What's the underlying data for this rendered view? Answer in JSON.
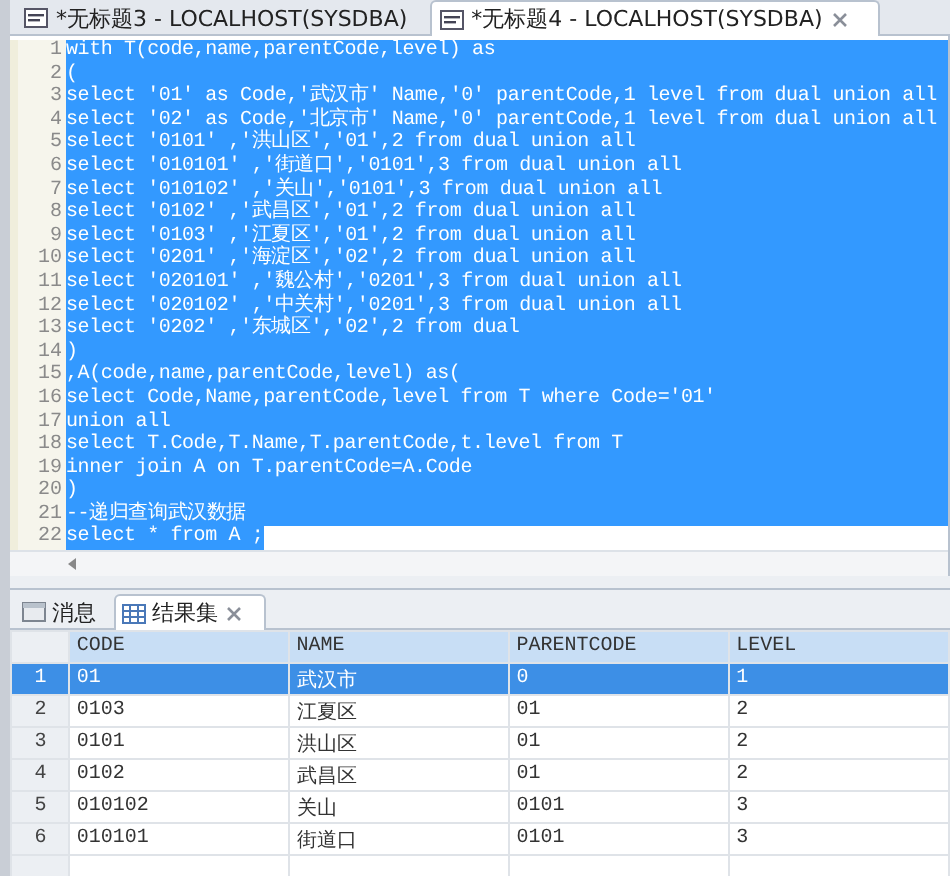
{
  "tabs": [
    {
      "label": "*无标题3 - LOCALHOST(SYSDBA)",
      "selected": false
    },
    {
      "label": "*无标题4 - LOCALHOST(SYSDBA)",
      "selected": true
    }
  ],
  "editor": {
    "lines": [
      {
        "number": "1",
        "text": "with T(code,name,parentCode,level) as",
        "kind": "full"
      },
      {
        "number": "2",
        "text": "(",
        "kind": "full"
      },
      {
        "number": "3",
        "text": "select '01' as Code,'武汉市' Name,'0' parentCode,1 level from dual union all",
        "kind": "full"
      },
      {
        "number": "4",
        "text": "select '02' as Code,'北京市' Name,'0' parentCode,1 level from dual union all",
        "kind": "full"
      },
      {
        "number": "5",
        "text": "select '0101' ,'洪山区','01',2 from dual union all",
        "kind": "full"
      },
      {
        "number": "6",
        "text": "select '010101' ,'街道口','0101',3 from dual union all",
        "kind": "full"
      },
      {
        "number": "7",
        "text": "select '010102' ,'关山','0101',3 from dual union all",
        "kind": "full"
      },
      {
        "number": "8",
        "text": "select '0102' ,'武昌区','01',2 from dual union all",
        "kind": "full"
      },
      {
        "number": "9",
        "text": "select '0103' ,'江夏区','01',2 from dual union all",
        "kind": "full"
      },
      {
        "number": "10",
        "text": "select '0201' ,'海淀区','02',2 from dual union all",
        "kind": "full"
      },
      {
        "number": "11",
        "text": "select '020101' ,'魏公村','0201',3 from dual union all",
        "kind": "full"
      },
      {
        "number": "12",
        "text": "select '020102' ,'中关村','0201',3 from dual union all",
        "kind": "full"
      },
      {
        "number": "13",
        "text": "select '0202' ,'东城区','02',2 from dual",
        "kind": "full"
      },
      {
        "number": "14",
        "text": ")",
        "kind": "full"
      },
      {
        "number": "15",
        "text": ",A(code,name,parentCode,level) as(",
        "kind": "full"
      },
      {
        "number": "16",
        "text": "select Code,Name,parentCode,level from T where Code='01'",
        "kind": "full"
      },
      {
        "number": "17",
        "text": "union all",
        "kind": "full"
      },
      {
        "number": "18",
        "text": "select T.Code,T.Name,T.parentCode,t.level from T",
        "kind": "full"
      },
      {
        "number": "19",
        "text": "inner join A on T.parentCode=A.Code",
        "kind": "full"
      },
      {
        "number": "20",
        "text": ")",
        "kind": "full"
      },
      {
        "number": "21",
        "text": "--递归查询武汉数据",
        "kind": "full"
      },
      {
        "number": "22",
        "text": "select * from A ;",
        "kind": "partial"
      }
    ]
  },
  "results": {
    "tabs": [
      {
        "label": "消息",
        "kind": "messages",
        "selected": false
      },
      {
        "label": "结果集",
        "kind": "resultset",
        "selected": true
      }
    ],
    "table": {
      "columns": [
        "CODE",
        "NAME",
        "PARENTCODE",
        "LEVEL"
      ],
      "rows": [
        {
          "number": "1",
          "cells": [
            "01",
            "武汉市",
            "0",
            "1"
          ],
          "selected": true
        },
        {
          "number": "2",
          "cells": [
            "0103",
            "江夏区",
            "01",
            "2"
          ],
          "selected": false
        },
        {
          "number": "3",
          "cells": [
            "0101",
            "洪山区",
            "01",
            "2"
          ],
          "selected": false
        },
        {
          "number": "4",
          "cells": [
            "0102",
            "武昌区",
            "01",
            "2"
          ],
          "selected": false
        },
        {
          "number": "5",
          "cells": [
            "010102",
            "关山",
            "0101",
            "3"
          ],
          "selected": false
        },
        {
          "number": "6",
          "cells": [
            "010101",
            "街道口",
            "0101",
            "3"
          ],
          "selected": false
        }
      ]
    }
  }
}
